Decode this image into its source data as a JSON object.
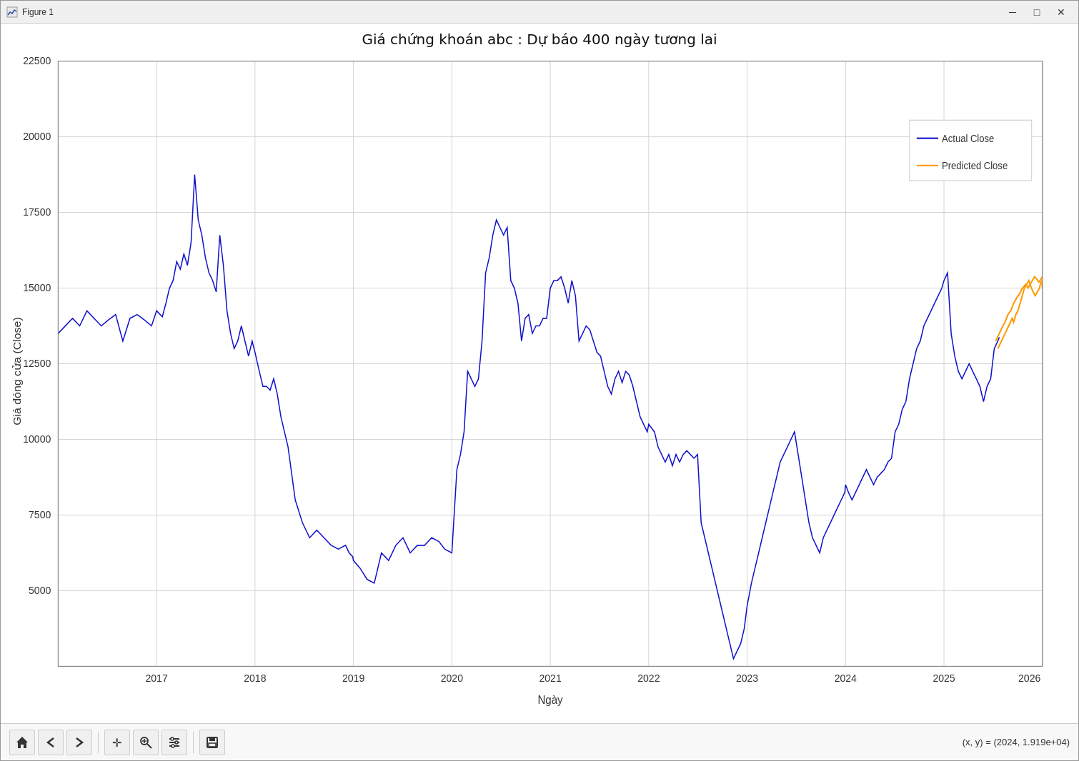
{
  "window": {
    "title": "Figure 1"
  },
  "titlebar": {
    "minimize_label": "─",
    "maximize_label": "□",
    "close_label": "✕"
  },
  "chart": {
    "title": "Giá chứng khoán abc : Dự báo 400 ngày tương lai",
    "x_label": "Ngày",
    "y_label": "Giá đóng cửa (Close)",
    "y_ticks": [
      "22500",
      "20000",
      "17500",
      "15000",
      "12500",
      "10000",
      "7500",
      "5000"
    ],
    "x_ticks": [
      "2017",
      "2018",
      "2019",
      "2020",
      "2021",
      "2022",
      "2023",
      "2024",
      "2025",
      "2026"
    ],
    "legend": {
      "actual_label": "Actual Close",
      "predicted_label": "Predicted Close"
    },
    "colors": {
      "actual": "#0000cc",
      "predicted": "#ff9900",
      "grid": "#cccccc",
      "background": "#ffffff",
      "plot_bg": "#ffffff"
    }
  },
  "toolbar": {
    "coords": "(x, y) = (2024, 1.919e+04)"
  }
}
